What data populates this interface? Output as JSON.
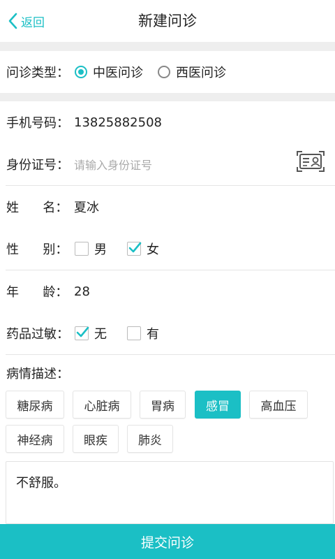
{
  "header": {
    "back_label": "返回",
    "title": "新建问诊"
  },
  "consult_type": {
    "label": "问诊类型：",
    "options": [
      {
        "label": "中医问诊",
        "selected": true
      },
      {
        "label": "西医问诊",
        "selected": false
      }
    ]
  },
  "phone": {
    "label": "手机号码：",
    "value": "13825882508"
  },
  "id_card": {
    "label": "身份证号：",
    "placeholder": "请输入身份证号",
    "value": ""
  },
  "name": {
    "label": "姓      名：",
    "value": "夏冰"
  },
  "gender": {
    "label": "性      别：",
    "options": [
      {
        "label": "男",
        "checked": false
      },
      {
        "label": "女",
        "checked": true
      }
    ]
  },
  "age": {
    "label": "年      龄：",
    "value": "28"
  },
  "allergy": {
    "label": "药品过敏：",
    "options": [
      {
        "label": "无",
        "checked": true
      },
      {
        "label": "有",
        "checked": false
      }
    ]
  },
  "condition": {
    "label": "病情描述：",
    "tags": [
      {
        "label": "糖尿病",
        "active": false
      },
      {
        "label": "心脏病",
        "active": false
      },
      {
        "label": "胃病",
        "active": false
      },
      {
        "label": "感冒",
        "active": true
      },
      {
        "label": "高血压",
        "active": false
      },
      {
        "label": "神经病",
        "active": false
      },
      {
        "label": "眼疾",
        "active": false
      },
      {
        "label": "肺炎",
        "active": false
      }
    ],
    "description": "不舒服。"
  },
  "submit_label": "提交问诊",
  "colors": {
    "accent": "#1bbfc5",
    "section_gap": "#eeeeee"
  }
}
